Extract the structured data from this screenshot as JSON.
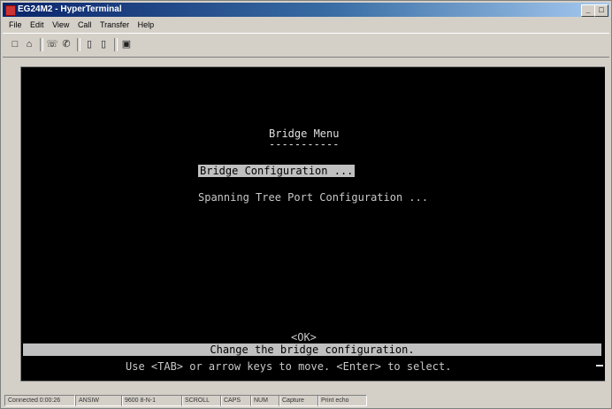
{
  "window": {
    "title": "EG24M2 - HyperTerminal"
  },
  "menubar": {
    "items": [
      "File",
      "Edit",
      "View",
      "Call",
      "Transfer",
      "Help"
    ]
  },
  "terminal": {
    "menu_title": "Bridge Menu",
    "menu_underline": "-----------",
    "items": [
      {
        "label": "Bridge Configuration ...",
        "selected": true
      },
      {
        "label": "Spanning Tree Port Configuration ...",
        "selected": false
      }
    ],
    "ok_label": "<OK>",
    "status_text": "Change the bridge configuration.",
    "help_text": "Use <TAB> or arrow keys to move. <Enter> to select."
  },
  "statusbar": {
    "items": [
      "Connected 0:00:26",
      "ANSIW",
      "9600 8-N-1",
      "SCROLL",
      "CAPS",
      "NUM",
      "Capture",
      "Print echo"
    ]
  }
}
